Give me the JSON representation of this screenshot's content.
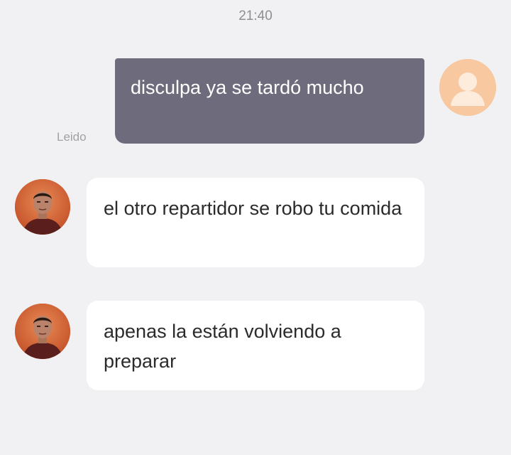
{
  "chat": {
    "timestamp": "21:40",
    "read_status": "Leido",
    "messages": [
      {
        "sender": "me",
        "text": "disculpa ya se tardó mucho"
      },
      {
        "sender": "other",
        "text": "el otro repartidor se robo tu comida"
      },
      {
        "sender": "other",
        "text": "apenas la están volviendo  a preparar"
      }
    ]
  },
  "avatars": {
    "me": {
      "icon": "default-user-avatar-icon",
      "color": "#f8c8a0"
    },
    "other": {
      "icon": "user-photo-avatar",
      "color": "#d9683a"
    }
  },
  "colors": {
    "background": "#f1f1f3",
    "outgoing_bubble": "#6e6c7c",
    "incoming_bubble": "#ffffff"
  }
}
